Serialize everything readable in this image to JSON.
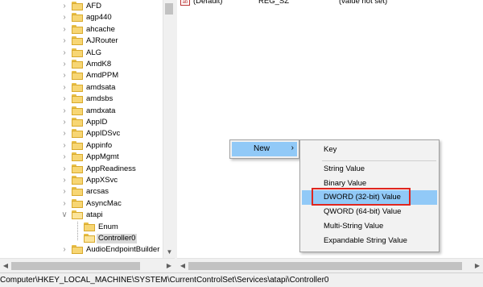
{
  "tree": {
    "items": [
      {
        "label": "AFD",
        "open": false,
        "selected": false
      },
      {
        "label": "agp440",
        "open": false,
        "selected": false
      },
      {
        "label": "ahcache",
        "open": false,
        "selected": false
      },
      {
        "label": "AJRouter",
        "open": false,
        "selected": false
      },
      {
        "label": "ALG",
        "open": false,
        "selected": false
      },
      {
        "label": "AmdK8",
        "open": false,
        "selected": false
      },
      {
        "label": "AmdPPM",
        "open": false,
        "selected": false
      },
      {
        "label": "amdsata",
        "open": false,
        "selected": false
      },
      {
        "label": "amdsbs",
        "open": false,
        "selected": false
      },
      {
        "label": "amdxata",
        "open": false,
        "selected": false
      },
      {
        "label": "AppID",
        "open": false,
        "selected": false
      },
      {
        "label": "AppIDSvc",
        "open": false,
        "selected": false
      },
      {
        "label": "Appinfo",
        "open": false,
        "selected": false
      },
      {
        "label": "AppMgmt",
        "open": false,
        "selected": false
      },
      {
        "label": "AppReadiness",
        "open": false,
        "selected": false
      },
      {
        "label": "AppXSvc",
        "open": false,
        "selected": false
      },
      {
        "label": "arcsas",
        "open": false,
        "selected": false
      },
      {
        "label": "AsyncMac",
        "open": false,
        "selected": false
      },
      {
        "label": "atapi",
        "open": true,
        "selected": false
      },
      {
        "label": "Enum",
        "open": false,
        "selected": false
      },
      {
        "label": "Controller0",
        "open": true,
        "selected": true
      },
      {
        "label": "AudioEndpointBuilder",
        "open": false,
        "selected": false
      }
    ]
  },
  "values": {
    "row": {
      "name": "(Default)",
      "type": "REG_SZ",
      "data": "(value not set)",
      "icon": "ab"
    }
  },
  "context_menu": {
    "new_label": "New",
    "arrow": "›"
  },
  "submenu": {
    "items": [
      "Key",
      "String Value",
      "Binary Value",
      "DWORD (32-bit) Value",
      "QWORD (64-bit) Value",
      "Multi-String Value",
      "Expandable String Value"
    ],
    "highlighted": "DWORD (32-bit) Value"
  },
  "statusbar": {
    "path": "Computer\\HKEY_LOCAL_MACHINE\\SYSTEM\\CurrentControlSet\\Services\\atapi\\Controller0"
  },
  "colors": {
    "highlight": "#91c9f7",
    "annotation_box": "#e0261f",
    "folder": "#f7d674"
  }
}
